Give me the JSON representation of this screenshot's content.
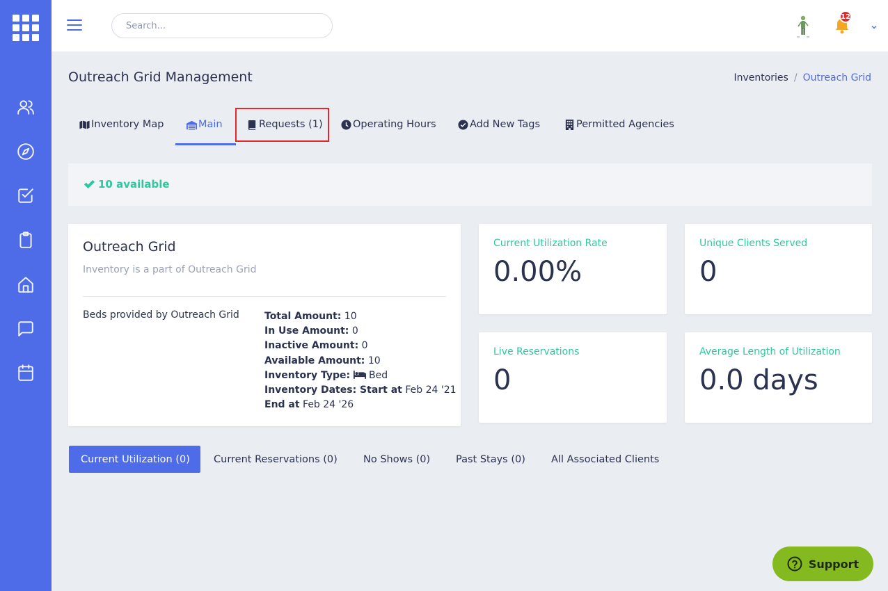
{
  "header": {
    "search_placeholder": "Search...",
    "notification_count": "12"
  },
  "page": {
    "title": "Outreach Grid Management",
    "breadcrumb": [
      "Inventories",
      "/",
      "Outreach Grid"
    ]
  },
  "tabs": [
    {
      "label": "Inventory Map",
      "icon": "map-icon"
    },
    {
      "label": "Main",
      "icon": "warehouse-icon",
      "active": true
    },
    {
      "label": "Requests (1)",
      "icon": "book-icon",
      "highlighted": true
    },
    {
      "label": "Operating Hours",
      "icon": "clock-icon"
    },
    {
      "label": "Add New Tags",
      "icon": "check-circle-icon"
    },
    {
      "label": "Permitted Agencies",
      "icon": "building-icon"
    }
  ],
  "availability": {
    "text": "10 available"
  },
  "inventory": {
    "title": "Outreach Grid",
    "subtitle": "Inventory is a part of Outreach Grid",
    "beds_label": "Beds provided by Outreach Grid",
    "total_label": "Total Amount:",
    "total_value": " 10",
    "in_use_label": "In Use Amount:",
    "in_use_value": " 0",
    "inactive_label": "Inactive Amount:",
    "inactive_value": " 0",
    "available_label": "Available Amount:",
    "available_value": " 10",
    "type_label": "Inventory Type:",
    "type_value": " Bed",
    "dates_label": "Inventory Dates:",
    "start_label": " Start at",
    "start_value": " Feb 24 '21",
    "end_label": "End at",
    "end_value": " Feb 24 '26"
  },
  "stats": [
    {
      "label": "Current Utilization Rate",
      "value": "0.00%"
    },
    {
      "label": "Unique Clients Served",
      "value": "0"
    },
    {
      "label": "Live Reservations",
      "value": "0"
    },
    {
      "label": "Average Length of Utilization",
      "value": "0.0 days"
    }
  ],
  "bottom_tabs": [
    {
      "label": "Current Utilization (0)",
      "active": true
    },
    {
      "label": "Current Reservations (0)"
    },
    {
      "label": "No Shows (0)"
    },
    {
      "label": "Past Stays (0)"
    },
    {
      "label": "All Associated Clients"
    }
  ],
  "support": {
    "label": "Support"
  },
  "colors": {
    "primary": "#4e6be8",
    "accent_green": "#2ec7a0",
    "support_green": "#84ba20",
    "badge_red": "#e5262a",
    "text_dark": "#2b3250"
  }
}
